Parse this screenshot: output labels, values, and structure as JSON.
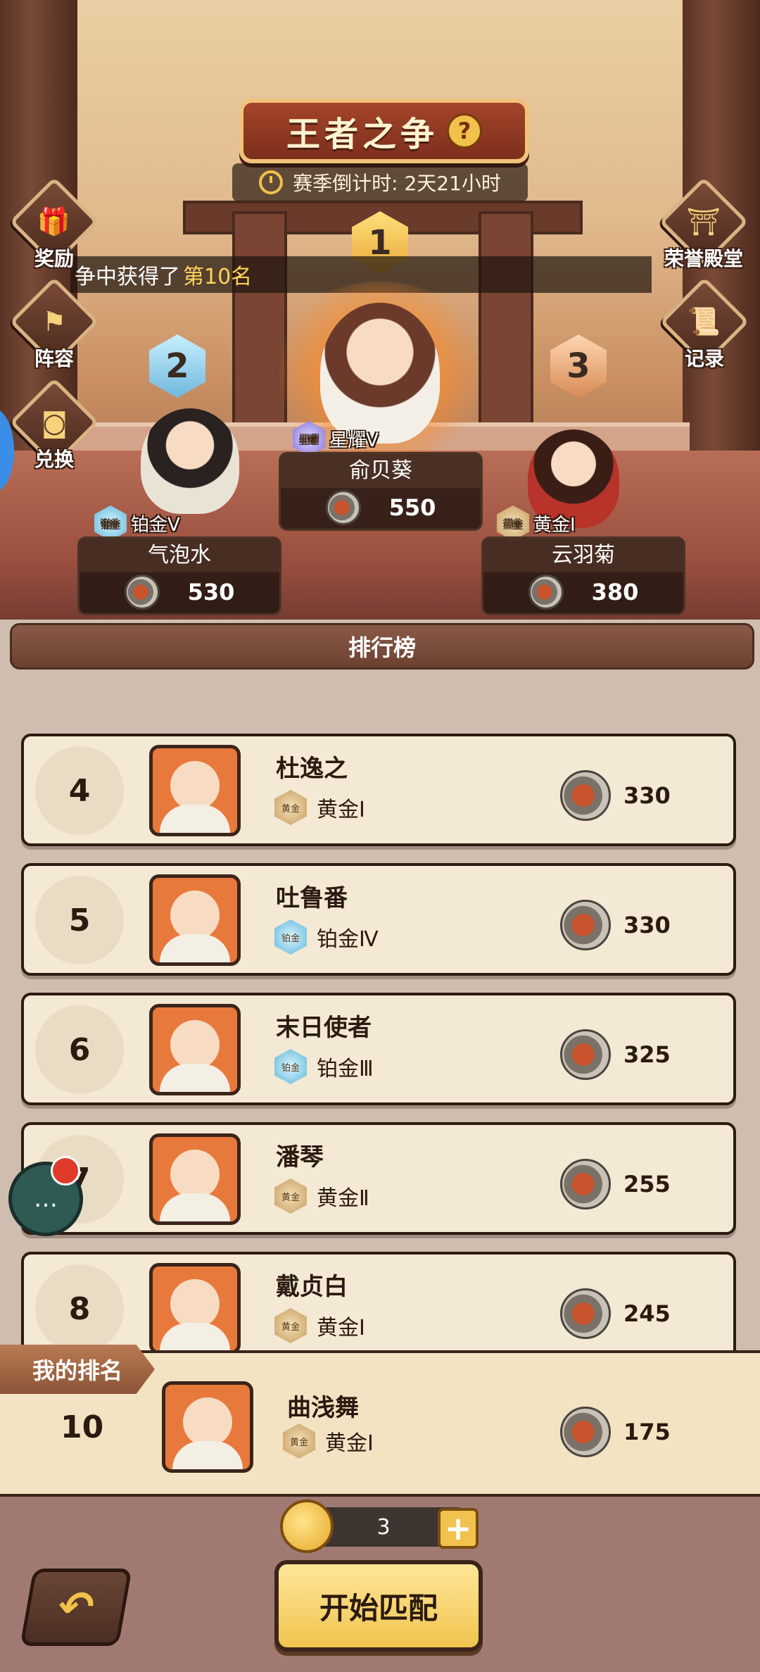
{
  "header": {
    "title": "王者之争",
    "help_icon": "?",
    "countdown": "赛季倒计时: 2天21小时"
  },
  "banner": {
    "text": "争中获得了",
    "highlight": "第10名"
  },
  "side_left": [
    {
      "label": "奖励",
      "icon": "gift-icon"
    },
    {
      "label": "阵容",
      "icon": "flag-icon"
    },
    {
      "label": "兑换",
      "icon": "coin-icon"
    }
  ],
  "side_right": [
    {
      "label": "荣誉殿堂",
      "icon": "temple-icon"
    },
    {
      "label": "记录",
      "icon": "scroll-icon"
    }
  ],
  "podium": [
    {
      "rank": "1",
      "name": "俞贝葵",
      "tier": "星耀V",
      "tier_badge": "星耀",
      "score": "550"
    },
    {
      "rank": "2",
      "name": "气泡水",
      "tier": "铂金V",
      "tier_badge": "铂金",
      "score": "530"
    },
    {
      "rank": "3",
      "name": "云羽菊",
      "tier": "黄金Ⅰ",
      "tier_badge": "黄金",
      "score": "380"
    }
  ],
  "board": {
    "title": "排行榜",
    "rows": [
      {
        "rank": "4",
        "name": "杜逸之",
        "tier": "黄金Ⅰ",
        "tier_badge": "黄金",
        "score": "330"
      },
      {
        "rank": "5",
        "name": "吐鲁番",
        "tier": "铂金Ⅳ",
        "tier_badge": "铂金",
        "score": "330"
      },
      {
        "rank": "6",
        "name": "末日使者",
        "tier": "铂金Ⅲ",
        "tier_badge": "铂金",
        "score": "325"
      },
      {
        "rank": "7",
        "name": "潘琴",
        "tier": "黄金Ⅱ",
        "tier_badge": "黄金",
        "score": "255"
      },
      {
        "rank": "8",
        "name": "戴贞白",
        "tier": "黄金Ⅰ",
        "tier_badge": "黄金",
        "score": "245"
      }
    ]
  },
  "my_rank": {
    "label": "我的排名",
    "rank": "10",
    "name": "曲浅舞",
    "tier": "黄金Ⅰ",
    "tier_badge": "黄金",
    "score": "175"
  },
  "bottom": {
    "tickets": "3",
    "plus": "+",
    "match_label": "开始匹配",
    "back_icon": "↶"
  },
  "colors": {
    "accent": "#f0c54f",
    "panel": "#f3e9d4",
    "frame": "#3b241a"
  }
}
